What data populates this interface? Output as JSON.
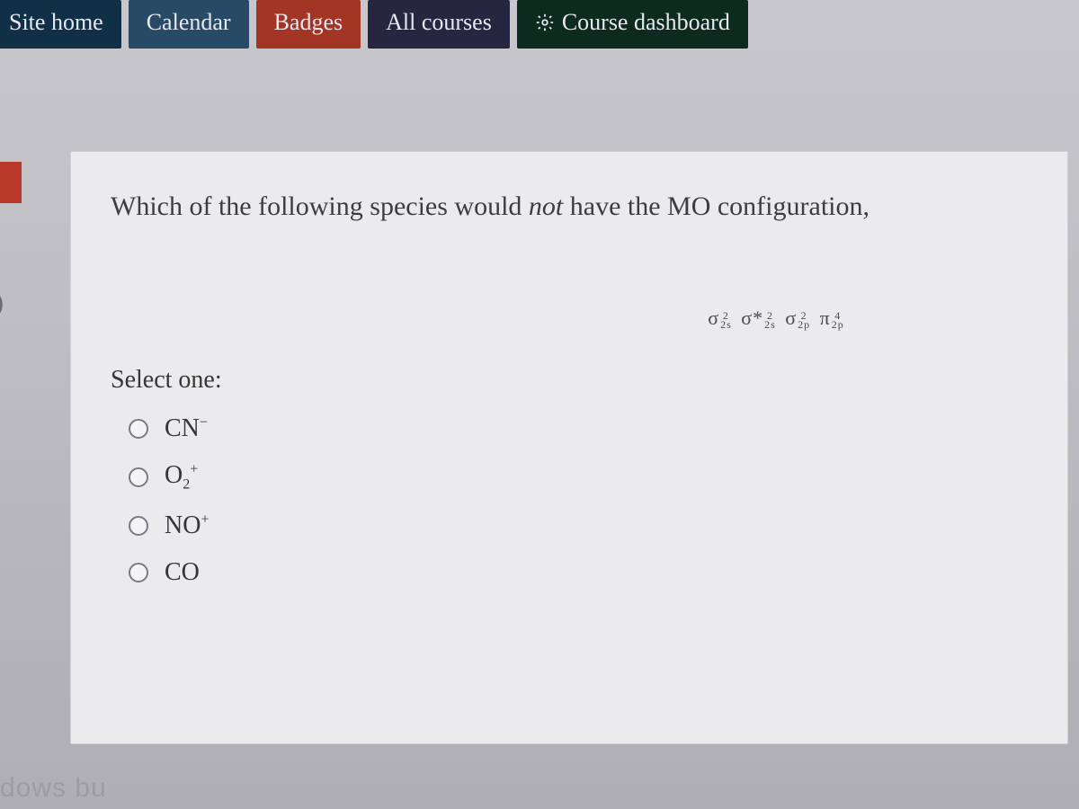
{
  "nav": {
    "site_home": "Site home",
    "calendar": "Calendar",
    "badges": "Badges",
    "all_courses": "All courses",
    "course_dashboard": "Course dashboard"
  },
  "question": {
    "prefix": "Which of the following species would ",
    "em": "not",
    "suffix": " have the MO configuration,"
  },
  "formula_terms": {
    "t1_base": "σ",
    "t1_sup": "2",
    "t1_sub": "2s",
    "t2_base": "σ*",
    "t2_sup": "2",
    "t2_sub": "2s",
    "t3_base": "σ",
    "t3_sup": "2",
    "t3_sub": "2p",
    "t4_base": "π",
    "t4_sup": "4",
    "t4_sub": "2p"
  },
  "select_label": "Select one:",
  "options": {
    "a_base": "CN",
    "a_sup": "−",
    "b_base": "O",
    "b_sub": "2",
    "b_sup": "+",
    "c_base": "NO",
    "c_sup": "+",
    "d_base": "CO"
  },
  "watermark": "dows bu"
}
